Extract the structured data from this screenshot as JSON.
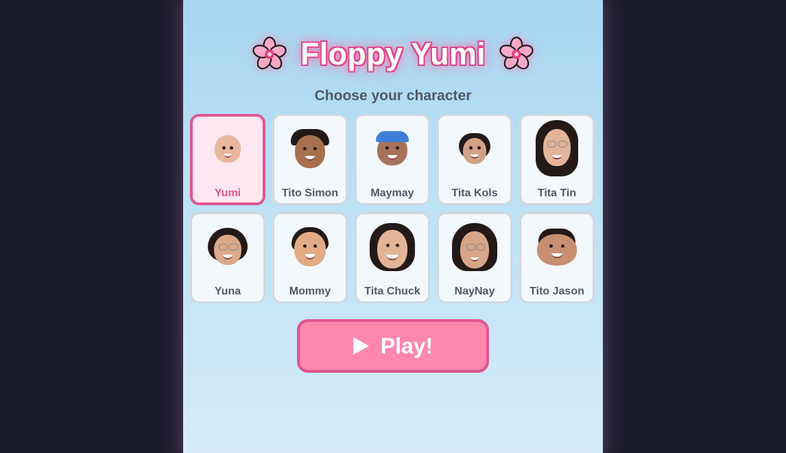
{
  "title": {
    "text": "Floppy Yumi",
    "left_icon": "cherry-blossom-icon",
    "right_icon": "cherry-blossom-icon"
  },
  "subtitle": "Choose your character",
  "selected_character": "Yumi",
  "characters": [
    {
      "name": "Yumi",
      "selected": true
    },
    {
      "name": "Tito Simon",
      "selected": false
    },
    {
      "name": "Maymay",
      "selected": false
    },
    {
      "name": "Tita Kols",
      "selected": false
    },
    {
      "name": "Tita Tin",
      "selected": false
    },
    {
      "name": "Yuna",
      "selected": false
    },
    {
      "name": "Mommy",
      "selected": false
    },
    {
      "name": "Tita Chuck",
      "selected": false
    },
    {
      "name": "NayNay",
      "selected": false
    },
    {
      "name": "Tito Jason",
      "selected": false
    }
  ],
  "play_button": {
    "label": "Play!",
    "icon": "play-triangle-icon"
  },
  "colors": {
    "page_background": "#1b1b2f",
    "sky_top": "#a8d7f0",
    "sky_bottom": "#d6ecfa",
    "accent_pink": "#e0558f",
    "button_pink": "#ff86ad",
    "card_background": "#f3f8fc",
    "selected_card_background": "#fde6f0"
  }
}
